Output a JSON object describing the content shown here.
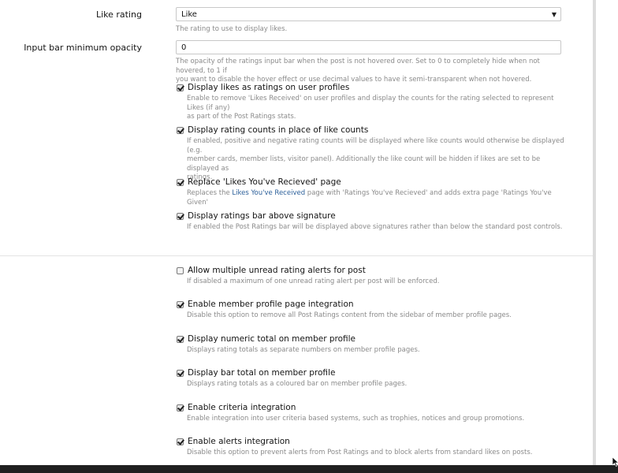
{
  "like_rating": {
    "label": "Like rating",
    "value": "Like",
    "hint": "The rating to use to display likes."
  },
  "opacity": {
    "label": "Input bar minimum opacity",
    "value": "0",
    "hint_line1": "The opacity of the ratings input bar when the post is not hovered over. Set to 0 to completely hide when not hovered, to 1 if",
    "hint_line2": "you want to disable the hover effect or use decimal values to have it semi-transparent when not hovered."
  },
  "options": [
    {
      "label": "Display likes as ratings on user profiles",
      "checked": true,
      "hint1": "Enable to remove 'Likes Received' on user profiles and display the counts for the rating selected to represent Likes (if any)",
      "hint2": "as part of the Post Ratings stats."
    },
    {
      "label": "Display rating counts in place of like counts",
      "checked": true,
      "hint1": "If enabled, positive and negative rating counts will be displayed where like counts would otherwise be displayed (e.g.",
      "hint2": "member cards, member lists, visitor panel). Additionally the like count will be hidden if likes are set to be displayed as",
      "hint3": "ratings."
    },
    {
      "label": "Replace 'Likes You've Recieved' page",
      "checked": true,
      "hint_prefix": "Replaces the ",
      "hint_link": "Likes You've Received",
      "hint_suffix": " page with 'Ratings You've Recieved' and adds extra page 'Ratings You've Given'"
    },
    {
      "label": "Display ratings bar above signature",
      "checked": true,
      "hint1": "If enabled the Post Ratings bar will be displayed above signatures rather than below the standard post controls."
    },
    {
      "label": "Allow multiple unread rating alerts for post",
      "checked": false,
      "hint1": "If disabled a maximum of one unread rating alert per post will be enforced."
    },
    {
      "label": "Enable member profile page integration",
      "checked": true,
      "hint1": "Disable this option to remove all Post Ratings content from the sidebar of member profile pages."
    },
    {
      "label": "Display numeric total on member profile",
      "checked": true,
      "hint1": "Displays rating totals as separate numbers on member profile pages."
    },
    {
      "label": "Display bar total on member profile",
      "checked": true,
      "hint1": "Displays rating totals as a coloured bar on member profile pages."
    },
    {
      "label": "Enable criteria integration",
      "checked": true,
      "hint1": "Enable integration into user criteria based systems, such as trophies, notices and group promotions."
    },
    {
      "label": "Enable alerts integration",
      "checked": true,
      "hint1": "Disable this option to prevent alerts from Post Ratings and to block alerts from standard likes on posts."
    }
  ]
}
